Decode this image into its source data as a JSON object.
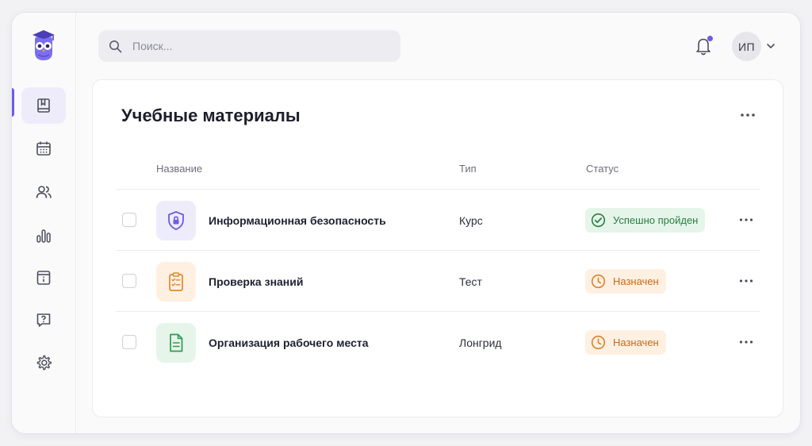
{
  "search": {
    "placeholder": "Поиск..."
  },
  "user": {
    "initials": "ИП"
  },
  "sidebar": {
    "items": [
      {
        "icon": "book-icon",
        "active": true
      },
      {
        "icon": "calendar-icon",
        "active": false
      },
      {
        "icon": "users-icon",
        "active": false
      },
      {
        "icon": "chart-icon",
        "active": false
      },
      {
        "icon": "document-info-icon",
        "active": false
      },
      {
        "icon": "help-chat-icon",
        "active": false
      },
      {
        "icon": "gear-icon",
        "active": false
      }
    ]
  },
  "page": {
    "title": "Учебные материалы",
    "columns": {
      "name": "Название",
      "type": "Тип",
      "status": "Статус"
    },
    "rows": [
      {
        "name": "Информационная безопасность",
        "type": "Курс",
        "status": "Успешно пройден",
        "status_kind": "success",
        "icon": "shield-lock-icon"
      },
      {
        "name": "Проверка знаний",
        "type": "Тест",
        "status": "Назначен",
        "status_kind": "pending",
        "icon": "checklist-clipboard-icon"
      },
      {
        "name": "Организация рабочего места",
        "type": "Лонгрид",
        "status": "Назначен",
        "status_kind": "pending",
        "icon": "document-icon"
      }
    ]
  },
  "colors": {
    "accent": "#6c5ce7",
    "success": "#2a7d42",
    "pending": "#c26a1a"
  }
}
